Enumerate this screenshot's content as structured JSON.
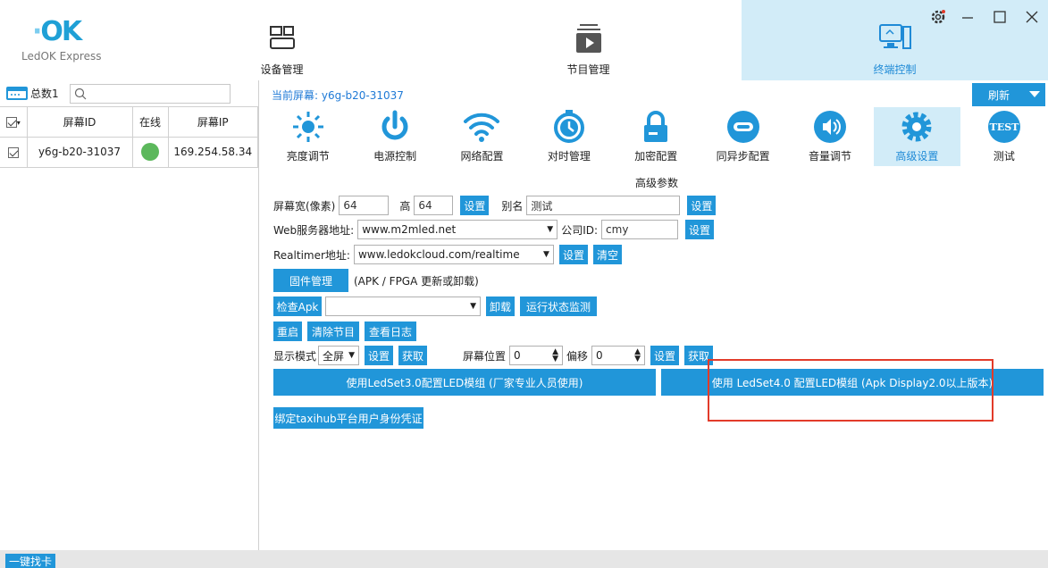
{
  "app": {
    "logo_mark": "OK",
    "logo_text": "LedOK Express"
  },
  "nav": {
    "device": "设备管理",
    "program": "节目管理",
    "terminal": "终端控制"
  },
  "left": {
    "total_label": "总数1",
    "search_placeholder": "",
    "headers": {
      "id": "屏幕ID",
      "online": "在线",
      "ip": "屏幕IP"
    },
    "rows": [
      {
        "id": "y6g-b20-31037",
        "online": true,
        "ip": "169.254.58.34"
      }
    ]
  },
  "current_screen": "当前屏幕: y6g-b20-31037",
  "refresh_label": "刷新",
  "functions": [
    {
      "label": "亮度调节",
      "icon": "brightness-icon"
    },
    {
      "label": "电源控制",
      "icon": "power-icon"
    },
    {
      "label": "网络配置",
      "icon": "wifi-icon"
    },
    {
      "label": "对时管理",
      "icon": "clock-icon"
    },
    {
      "label": "加密配置",
      "icon": "lock-icon"
    },
    {
      "label": "同异步配置",
      "icon": "sync-icon"
    },
    {
      "label": "音量调节",
      "icon": "volume-icon"
    },
    {
      "label": "高级设置",
      "icon": "gear-icon"
    },
    {
      "label": "测试",
      "icon": "test-icon"
    }
  ],
  "advanced": {
    "title": "高级参数",
    "screen_width_label": "屏幕宽(像素)",
    "screen_width_value": "64",
    "height_label": "高",
    "height_value": "64",
    "set_label": "设置",
    "alias_label": "别名",
    "alias_value": "测试",
    "web_server_label": "Web服务器地址:",
    "web_server_value": "www.m2mled.net",
    "company_label": "公司ID:",
    "company_value": "cmy",
    "realtimer_label": "Realtimer地址:",
    "realtimer_value": "www.ledokcloud.com/realtime",
    "clear_label": "清空",
    "firmware_label": "固件管理",
    "firmware_note": "(APK / FPGA 更新或卸载)",
    "check_apk_label": "检查Apk",
    "check_apk_value": "",
    "uninstall_label": "卸载",
    "monitor_label": "运行状态监测",
    "restart_label": "重启",
    "clear_program_label": "清除节目",
    "view_log_label": "查看日志",
    "display_mode_label": "显示模式",
    "display_mode_value": "全屏",
    "get_label": "获取",
    "screen_pos_label": "屏幕位置",
    "screen_pos_value": "0",
    "offset_label": "偏移",
    "offset_value": "0",
    "ledset3_label": "使用LedSet3.0配置LED模组 (厂家专业人员使用)",
    "ledset4_label": "使用 LedSet4.0 配置LED模组 (Apk Display2.0以上版本)",
    "bind_label": "绑定taxihub平台用户身份凭证"
  },
  "bottom": {
    "card_label": "一键找卡"
  },
  "colors": {
    "accent": "#2196d9",
    "active_bg": "#d2ecf8",
    "highlight": "#e23b2a",
    "online": "#5cb85c"
  }
}
